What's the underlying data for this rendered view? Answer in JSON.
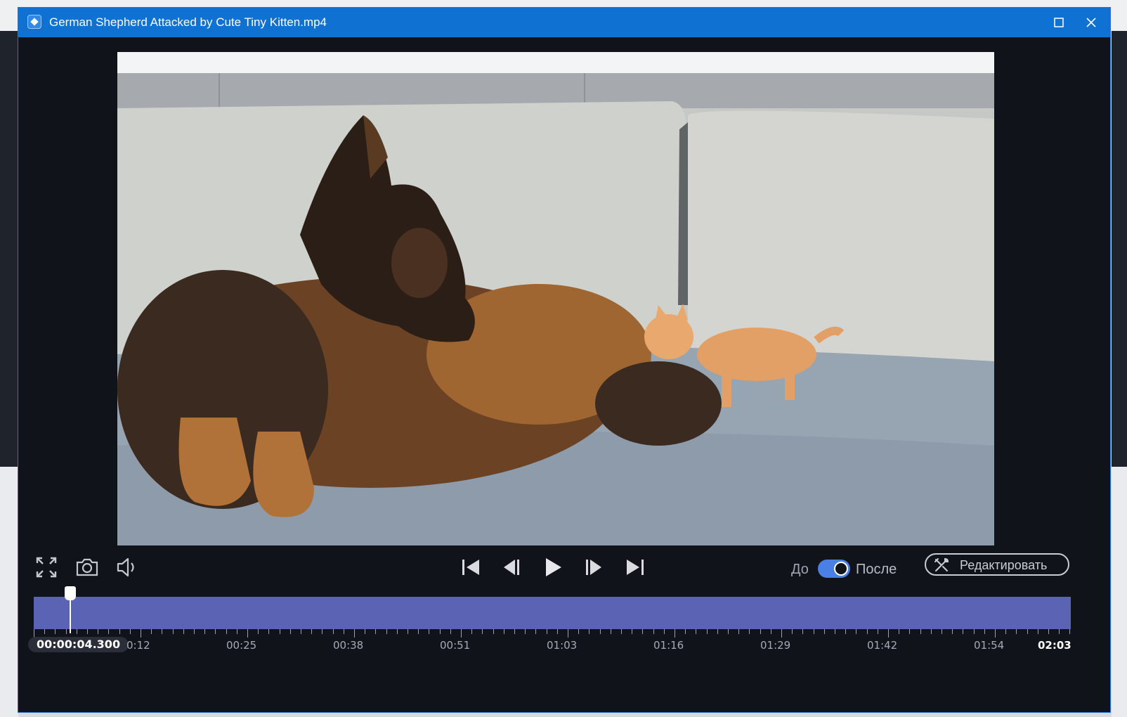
{
  "window": {
    "title": "German Shepherd Attacked by Cute Tiny Kitten.mp4"
  },
  "player": {
    "toggle_before": "До",
    "toggle_after": "После",
    "toggle_state": "after",
    "edit_label": "Редактировать",
    "current_time": "00:00:04.300",
    "end_time": "02:03",
    "timeline_ticks": [
      "0:12",
      "00:25",
      "00:38",
      "00:51",
      "01:03",
      "01:16",
      "01:29",
      "01:42",
      "01:54"
    ],
    "playhead_fraction": 0.035
  },
  "colors": {
    "titlebar": "#0f72d3",
    "timeline": "#5b63b5",
    "toggle_on": "#4a7fe6",
    "background": "#11131a"
  }
}
